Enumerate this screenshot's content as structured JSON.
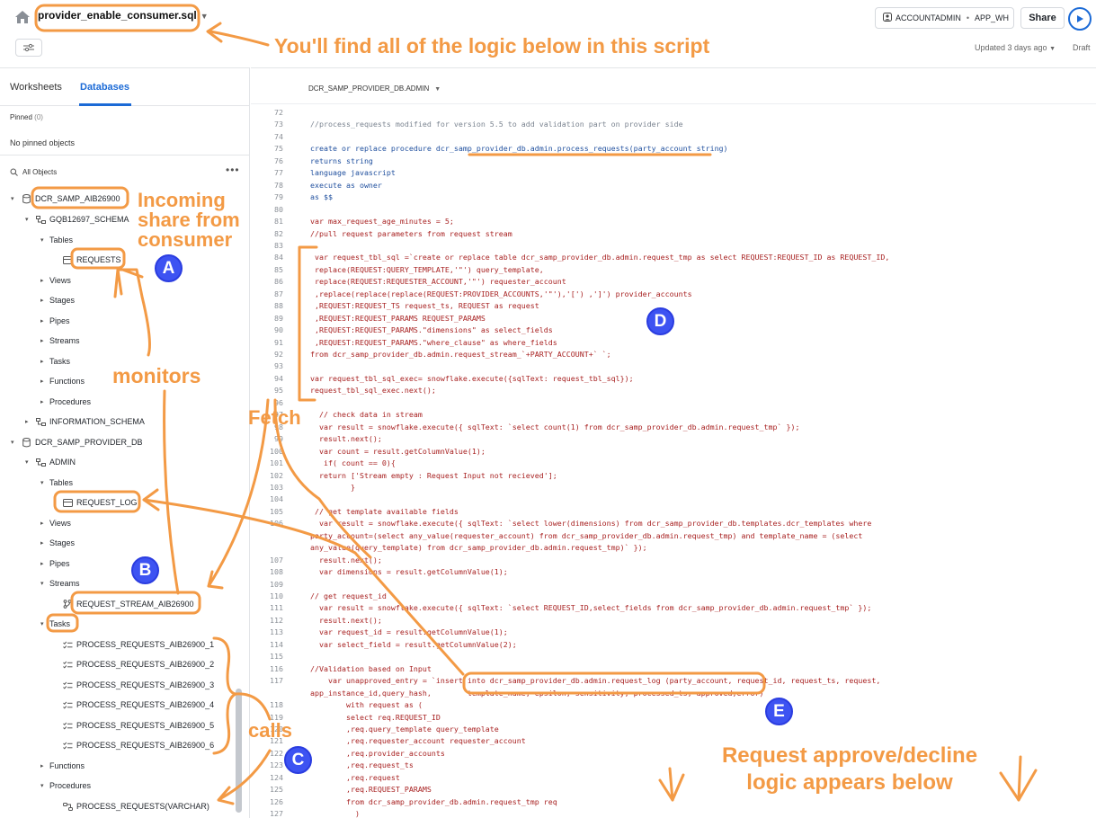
{
  "topbar": {
    "file_name": "provider_enable_consumer.sql",
    "role": "ACCOUNTADMIN",
    "warehouse": "APP_WH",
    "share_label": "Share",
    "updated": "Updated 3 days ago",
    "status": "Draft"
  },
  "sidebar": {
    "tab_worksheets": "Worksheets",
    "tab_databases": "Databases",
    "pinned_label": "Pinned",
    "pinned_count": "(0)",
    "no_pinned": "No pinned objects",
    "all_objects": "All Objects",
    "tree": [
      {
        "label": "DCR_SAMP_AIB26900",
        "icon": "database-icon",
        "expanded": true
      },
      {
        "label": "GQB12697_SCHEMA",
        "icon": "schema-icon",
        "expanded": true
      },
      {
        "label": "Tables",
        "icon": "",
        "expanded": true
      },
      {
        "label": "REQUESTS",
        "icon": "table-icon",
        "expanded": false
      },
      {
        "label": "Views",
        "icon": "",
        "expanded": false
      },
      {
        "label": "Stages",
        "icon": "",
        "expanded": false
      },
      {
        "label": "Pipes",
        "icon": "",
        "expanded": false
      },
      {
        "label": "Streams",
        "icon": "",
        "expanded": false
      },
      {
        "label": "Tasks",
        "icon": "",
        "expanded": false
      },
      {
        "label": "Functions",
        "icon": "",
        "expanded": false
      },
      {
        "label": "Procedures",
        "icon": "",
        "expanded": false
      },
      {
        "label": "INFORMATION_SCHEMA",
        "icon": "schema-icon",
        "expanded": false
      },
      {
        "label": "DCR_SAMP_PROVIDER_DB",
        "icon": "database-icon",
        "expanded": true
      },
      {
        "label": "ADMIN",
        "icon": "schema-icon",
        "expanded": true
      },
      {
        "label": "Tables",
        "icon": "",
        "expanded": true
      },
      {
        "label": "REQUEST_LOG",
        "icon": "table-icon",
        "expanded": false
      },
      {
        "label": "Views",
        "icon": "",
        "expanded": false
      },
      {
        "label": "Stages",
        "icon": "",
        "expanded": false
      },
      {
        "label": "Pipes",
        "icon": "",
        "expanded": false
      },
      {
        "label": "Streams",
        "icon": "",
        "expanded": true
      },
      {
        "label": "REQUEST_STREAM_AIB26900",
        "icon": "stream-icon",
        "expanded": false
      },
      {
        "label": "Tasks",
        "icon": "",
        "expanded": true
      },
      {
        "label": "PROCESS_REQUESTS_AIB26900_1",
        "icon": "task-icon",
        "expanded": false
      },
      {
        "label": "PROCESS_REQUESTS_AIB26900_2",
        "icon": "task-icon",
        "expanded": false
      },
      {
        "label": "PROCESS_REQUESTS_AIB26900_3",
        "icon": "task-icon",
        "expanded": false
      },
      {
        "label": "PROCESS_REQUESTS_AIB26900_4",
        "icon": "task-icon",
        "expanded": false
      },
      {
        "label": "PROCESS_REQUESTS_AIB26900_5",
        "icon": "task-icon",
        "expanded": false
      },
      {
        "label": "PROCESS_REQUESTS_AIB26900_6",
        "icon": "task-icon",
        "expanded": false
      },
      {
        "label": "Functions",
        "icon": "",
        "expanded": false
      },
      {
        "label": "Procedures",
        "icon": "",
        "expanded": true
      },
      {
        "label": "PROCESS_REQUESTS(VARCHAR)",
        "icon": "procedure-icon",
        "expanded": false
      }
    ]
  },
  "editor": {
    "context": "DCR_SAMP_PROVIDER_DB.ADMIN",
    "lines": [
      {
        "n": "72",
        "t": ""
      },
      {
        "n": "73",
        "t": "//process_requests modified for version 5.5 to add validation part on provider side",
        "c": "comment"
      },
      {
        "n": "74",
        "t": ""
      },
      {
        "n": "75",
        "t": "create or replace procedure dcr_samp_provider_db.admin.process_requests(party_account string)",
        "c": "kw"
      },
      {
        "n": "76",
        "t": "returns string",
        "c": "kw"
      },
      {
        "n": "77",
        "t": "language javascript",
        "c": "kw"
      },
      {
        "n": "78",
        "t": "execute as owner",
        "c": "kw"
      },
      {
        "n": "79",
        "t": "as $$",
        "c": "kw"
      },
      {
        "n": "80",
        "t": ""
      },
      {
        "n": "81",
        "t": "var max_request_age_minutes = 5;"
      },
      {
        "n": "82",
        "t": "//pull request parameters from request stream"
      },
      {
        "n": "83",
        "t": ""
      },
      {
        "n": "84",
        "t": " var request_tbl_sql =`create or replace table dcr_samp_provider_db.admin.request_tmp as select REQUEST:REQUEST_ID as REQUEST_ID,"
      },
      {
        "n": "85",
        "t": " replace(REQUEST:QUERY_TEMPLATE,'\"') query_template,"
      },
      {
        "n": "86",
        "t": " replace(REQUEST:REQUESTER_ACCOUNT,'\"') requester_account"
      },
      {
        "n": "87",
        "t": " ,replace(replace(replace(REQUEST:PROVIDER_ACCOUNTS,'\"'),'[') ,']') provider_accounts"
      },
      {
        "n": "88",
        "t": " ,REQUEST:REQUEST_TS request_ts, REQUEST as request"
      },
      {
        "n": "89",
        "t": " ,REQUEST:REQUEST_PARAMS REQUEST_PARAMS"
      },
      {
        "n": "90",
        "t": " ,REQUEST:REQUEST_PARAMS.\"dimensions\" as select_fields"
      },
      {
        "n": "91",
        "t": " ,REQUEST:REQUEST_PARAMS.\"where_clause\" as where_fields"
      },
      {
        "n": "92",
        "t": "from dcr_samp_provider_db.admin.request_stream_`+PARTY_ACCOUNT+` `;"
      },
      {
        "n": "93",
        "t": ""
      },
      {
        "n": "94",
        "t": "var request_tbl_sql_exec= snowflake.execute({sqlText: request_tbl_sql});"
      },
      {
        "n": "95",
        "t": "request_tbl_sql_exec.next();"
      },
      {
        "n": "96",
        "t": ""
      },
      {
        "n": "97",
        "t": "  // check data in stream"
      },
      {
        "n": "98",
        "t": "  var result = snowflake.execute({ sqlText: `select count(1) from dcr_samp_provider_db.admin.request_tmp` });"
      },
      {
        "n": "99",
        "t": "  result.next();"
      },
      {
        "n": "100",
        "t": "  var count = result.getColumnValue(1);"
      },
      {
        "n": "101",
        "t": "   if( count == 0){"
      },
      {
        "n": "102",
        "t": "  return ['Stream empty : Request Input not recieved'];"
      },
      {
        "n": "103",
        "t": "         }"
      },
      {
        "n": "104",
        "t": ""
      },
      {
        "n": "105",
        "t": " // get template available fields"
      },
      {
        "n": "106",
        "t": "  var result = snowflake.execute({ sqlText: `select lower(dimensions) from dcr_samp_provider_db.templates.dcr_templates where"
      },
      {
        "n": "",
        "t": "party_account=(select any_value(requester_account) from dcr_samp_provider_db.admin.request_tmp) and template_name = (select"
      },
      {
        "n": "",
        "t": "any_value(query_template) from dcr_samp_provider_db.admin.request_tmp)` });"
      },
      {
        "n": "107",
        "t": "  result.next();"
      },
      {
        "n": "108",
        "t": "  var dimensions = result.getColumnValue(1);"
      },
      {
        "n": "109",
        "t": ""
      },
      {
        "n": "110",
        "t": "// get request_id"
      },
      {
        "n": "111",
        "t": "  var result = snowflake.execute({ sqlText: `select REQUEST_ID,select_fields from dcr_samp_provider_db.admin.request_tmp` });"
      },
      {
        "n": "112",
        "t": "  result.next();"
      },
      {
        "n": "113",
        "t": "  var request_id = result.getColumnValue(1);"
      },
      {
        "n": "114",
        "t": "  var select_field = result.getColumnValue(2);"
      },
      {
        "n": "115",
        "t": ""
      },
      {
        "n": "116",
        "t": "//Validation based on Input"
      },
      {
        "n": "117",
        "t": "    var unapproved_entry = `insert into dcr_samp_provider_db.admin.request_log (party_account, request_id, request_ts, request,"
      },
      {
        "n": "",
        "t": "app_instance_id,query_hash,        template_name, epsilon, sensitivity, processed_ts, approved,error)"
      },
      {
        "n": "118",
        "t": "        with request as ("
      },
      {
        "n": "119",
        "t": "        select req.REQUEST_ID"
      },
      {
        "n": "120",
        "t": "        ,req.query_template query_template"
      },
      {
        "n": "121",
        "t": "        ,req.requester_account requester_account"
      },
      {
        "n": "122",
        "t": "        ,req.provider_accounts"
      },
      {
        "n": "123",
        "t": "        ,req.request_ts"
      },
      {
        "n": "124",
        "t": "        ,req.request"
      },
      {
        "n": "125",
        "t": "        ,req.REQUEST_PARAMS"
      },
      {
        "n": "126",
        "t": "        from dcr_samp_provider_db.admin.request_tmp req"
      },
      {
        "n": "127",
        "t": "          )"
      }
    ]
  },
  "annotations": {
    "script_note": "You'll find all of the logic below in this script",
    "incoming_1": "Incoming",
    "incoming_2": "share from",
    "incoming_3": "consumer",
    "monitors": "monitors",
    "fetch": "Fetch",
    "calls": "calls",
    "approve_1": "Request approve/decline",
    "approve_2": "logic appears below",
    "marker_a": "A",
    "marker_b": "B",
    "marker_c": "C",
    "marker_d": "D",
    "marker_e": "E"
  },
  "colors": {
    "annotation_orange": "#f39a45",
    "marker_blue": "#3d53f2",
    "accent_blue": "#1b6ad6"
  }
}
